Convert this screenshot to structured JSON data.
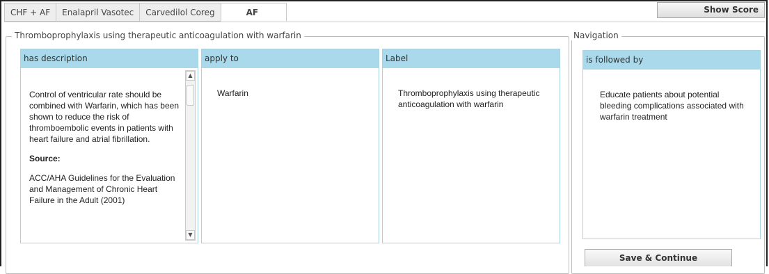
{
  "tabs": [
    {
      "label": "CHF + AF",
      "active": false
    },
    {
      "label": "Enalapril Vasotec",
      "active": false
    },
    {
      "label": "Carvedilol Coreg",
      "active": false
    },
    {
      "label": "AF",
      "active": true
    }
  ],
  "toolbar": {
    "show_score_label": "Show Score"
  },
  "main": {
    "legend": "Thromboprophylaxis using therapeutic anticoagulation with warfarin",
    "description": {
      "header": "has description",
      "text": "Control of ventricular rate should be combined with Warfarin, which has been shown to reduce the risk of thromboembolic events in patients with heart failure and atrial fibrillation.",
      "source_label": "Source:",
      "source_text": "ACC/AHA Guidelines for the Evaluation and Management of Chronic Heart Failure in the Adult (2001)"
    },
    "apply_to": {
      "header": "apply to",
      "text": "Warfarin"
    },
    "label": {
      "header": "Label",
      "text": "Thromboprophylaxis using therapeutic anticoagulation with warfarin"
    }
  },
  "navigation": {
    "legend": "Navigation",
    "followed_by": {
      "header": "is followed by",
      "text": "Educate patients about potential bleeding complications associated with warfarin treatment"
    },
    "save_label": "Save & Continue"
  },
  "colors": {
    "panel_header": "#a9d9ea",
    "panel_border": "#a9d3e0"
  }
}
